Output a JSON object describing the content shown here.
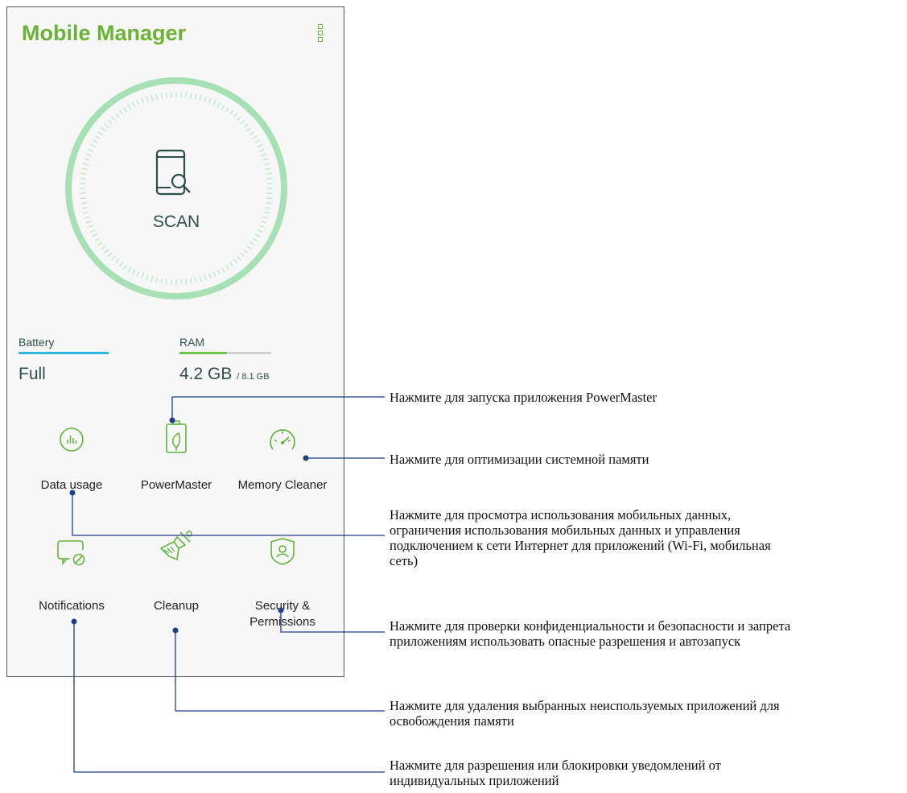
{
  "app": {
    "title": "Mobile Manager",
    "menu_icon": "more-vert-icon"
  },
  "scan": {
    "label": "SCAN",
    "icon": "phone-search-icon"
  },
  "stats": {
    "battery": {
      "label": "Battery",
      "value": "Full",
      "level": 1.0,
      "color": "#2db8e0"
    },
    "ram": {
      "label": "RAM",
      "value": "4.2 GB",
      "total": "/ 8.1 GB",
      "used_fraction": 0.52,
      "color": "#6ec44c"
    }
  },
  "tiles": [
    {
      "label": "Data usage",
      "icon": "data-usage-icon"
    },
    {
      "label": "PowerMaster",
      "icon": "battery-leaf-icon"
    },
    {
      "label": "Memory Cleaner",
      "icon": "speedometer-icon"
    },
    {
      "label": "Notifications",
      "icon": "notification-block-icon"
    },
    {
      "label": "Cleanup",
      "icon": "broom-icon"
    },
    {
      "label_line1": "Security &",
      "label_line2": "Permissions",
      "icon": "shield-user-icon"
    }
  ],
  "callouts": {
    "powermaster": "Нажмите для запуска приложения PowerMaster",
    "memory_cleaner": "Нажмите для оптимизации системной памяти",
    "data_usage": [
      "Нажмите для просмотра использования мобильных данных,",
      "ограничения использования мобильных данных и управления",
      "подключением к сети Интернет для приложений (Wi-Fi, мобильная",
      "сеть)"
    ],
    "security": [
      "Нажмите для проверки конфиденциальности и безопасности и запрета",
      "приложениям использовать опасные разрешения и автозапуск"
    ],
    "cleanup": [
      "Нажмите для удаления выбранных неиспользуемых приложений для",
      "освобождения памяти"
    ],
    "notifications": [
      "Нажмите для разрешения или блокировки уведомлений от",
      "индивидуальных приложений"
    ]
  },
  "colors": {
    "accent_green": "#6ab335",
    "icon_green": "#5fb53a",
    "dark_teal": "#2d4f4c",
    "callout_line": "#1f3f8a",
    "dial_ring": "#a6e0b4"
  }
}
